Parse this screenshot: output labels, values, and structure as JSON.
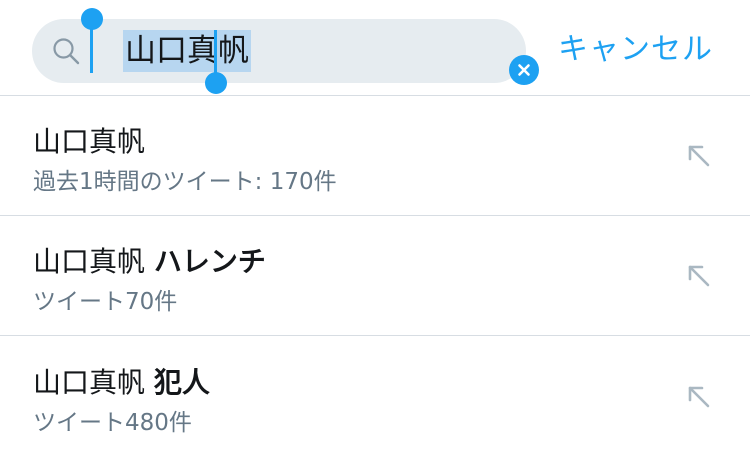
{
  "search": {
    "query": "山口真帆",
    "cancel_label": "キャンセル"
  },
  "suggestions": [
    {
      "term": "山口真帆",
      "extra": "",
      "subtitle": "過去1時間のツイート: 170件"
    },
    {
      "term": "山口真帆",
      "extra": "ハレンチ",
      "subtitle": "ツイート70件"
    },
    {
      "term": "山口真帆",
      "extra": "犯人",
      "subtitle": "ツイート480件"
    }
  ],
  "icons": {
    "search": "search-icon",
    "clear": "clear-icon",
    "fill_query": "arrow-up-left-icon"
  },
  "colors": {
    "accent": "#1da1f2",
    "field_bg": "#e6ecf0",
    "selection": "#b7d6f0",
    "primary_text": "#14171a",
    "secondary_text": "#657786",
    "divider": "#d7dde3"
  }
}
